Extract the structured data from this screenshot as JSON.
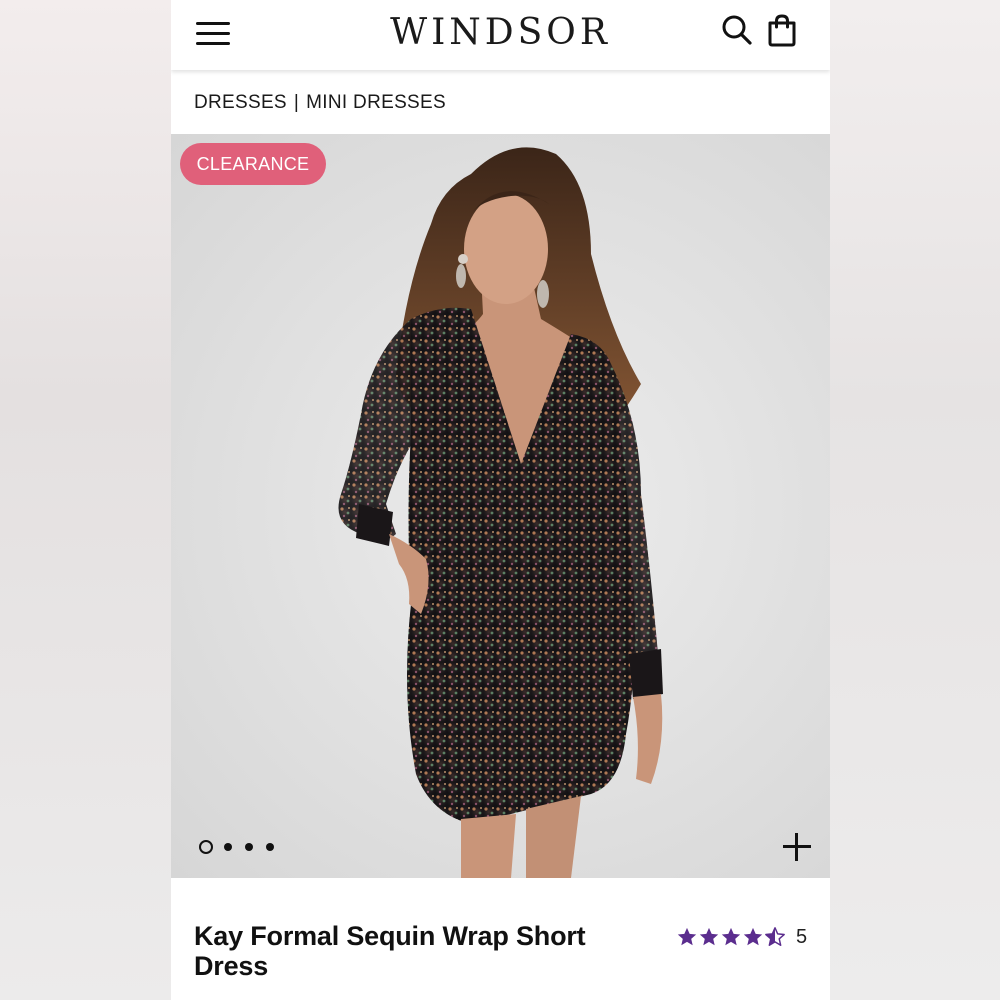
{
  "header": {
    "logo": "WINDSOR",
    "menu_icon": "hamburger-icon",
    "search_icon": "search-icon",
    "bag_icon": "shopping-bag-icon"
  },
  "breadcrumb": {
    "items": [
      "DRESSES",
      "MINI DRESSES"
    ],
    "separator": "|"
  },
  "product": {
    "badge": "CLEARANCE",
    "title": "Kay Formal Sequin Wrap Short Dress",
    "rating": 4.5,
    "rating_max": 5,
    "review_count": "5",
    "image_count": 4,
    "active_image": 1
  },
  "colors": {
    "badge": "#e0607a",
    "star": "#5b2d8e",
    "text": "#111111"
  }
}
